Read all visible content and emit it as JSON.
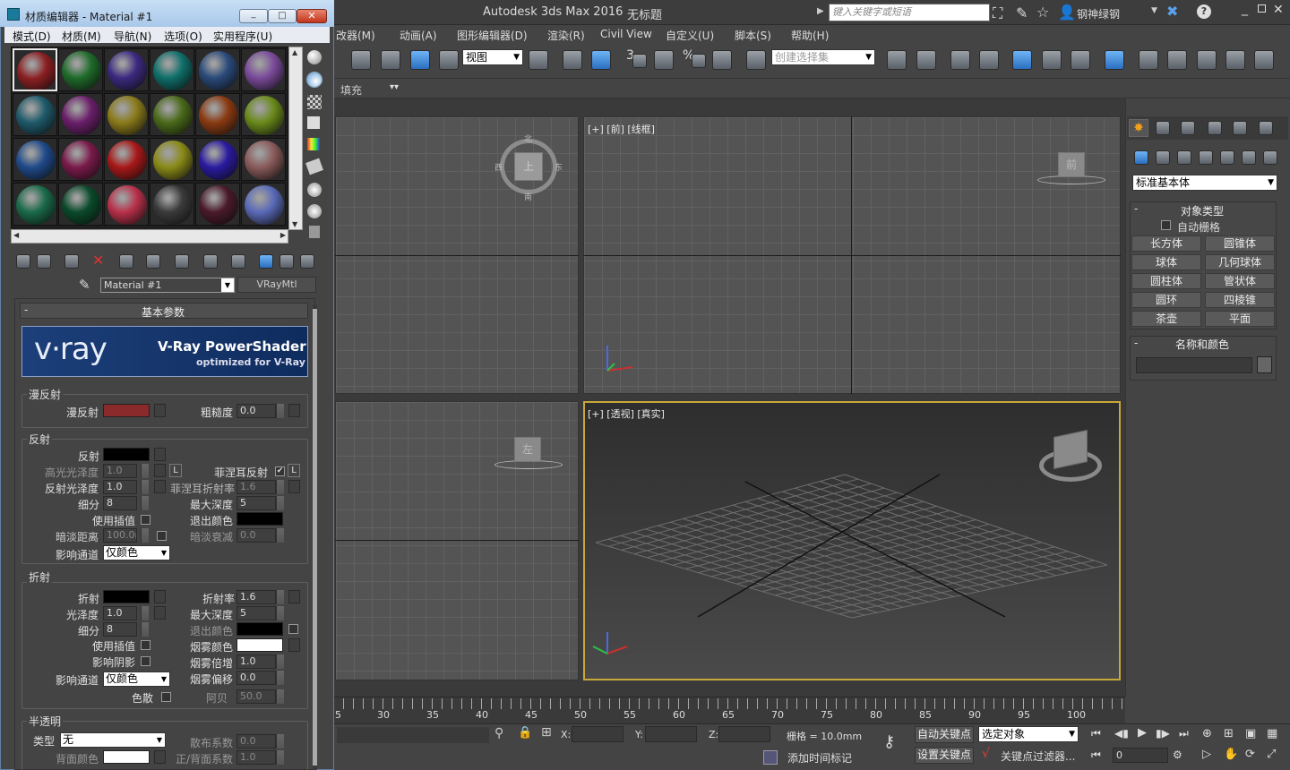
{
  "app": {
    "title": "Autodesk 3ds Max 2016",
    "doc_title": "无标题",
    "search_placeholder": "键入关键字或短语",
    "user": "钢神绿钢"
  },
  "menu": [
    "改器(M)",
    "动画(A)",
    "图形编辑器(D)",
    "渲染(R)",
    "Civil View",
    "自定义(U)",
    "脚本(S)",
    "帮助(H)"
  ],
  "toolbar": {
    "view_select": "视图",
    "selection_set": "创建选择集",
    "snap_3": "3",
    "snap_pct": "%"
  },
  "ribbon_row": {
    "fill_label": "填充"
  },
  "viewports": {
    "top_right_label": "[+] [前] [线框]",
    "bottom_right_label": "[+] [透视] [真实]",
    "front_cube": "前",
    "top_cube": "上",
    "left_cube": "左",
    "compass": [
      "北",
      "南",
      "东",
      "西"
    ]
  },
  "command_panel": {
    "category": "标准基本体",
    "rollout_object_type": "对象类型",
    "autogrid": "自动栅格",
    "buttons": [
      "长方体",
      "圆锥体",
      "球体",
      "几何球体",
      "圆柱体",
      "管状体",
      "圆环",
      "四棱锥",
      "茶壶",
      "平面"
    ],
    "rollout_name_color": "名称和颜色"
  },
  "timeline": {
    "ticks": [
      "5",
      "30",
      "35",
      "40",
      "45",
      "50",
      "55",
      "60",
      "65",
      "70",
      "75",
      "80",
      "85",
      "90",
      "95",
      "100"
    ]
  },
  "status": {
    "x_label": "X:",
    "y_label": "Y:",
    "z_label": "Z:",
    "grid": "栅格 = 10.0mm",
    "add_time_tag": "添加时间标记",
    "auto_key": "自动关键点",
    "set_key": "设置关键点",
    "selected_object": "选定对象",
    "key_filters": "关键点过滤器...",
    "frame": "0"
  },
  "mat_editor": {
    "title": "材质编辑器 - Material #1",
    "menu": [
      "模式(D)",
      "材质(M)",
      "导航(N)",
      "选项(O)",
      "实用程序(U)"
    ],
    "material_name": "Material #1",
    "material_type": "VRayMtl",
    "rollout_basic": "基本参数",
    "vray_brand": "v·ray",
    "vray_banner_title": "V-Ray PowerShader",
    "vray_banner_sub": "optimized for V-Ray",
    "sphere_colors": [
      "#8a1f22",
      "#1f6b2a",
      "#3c2a80",
      "#0f6f6a",
      "#2a4a7a",
      "#7a4a9a",
      "#1e5a6a",
      "#6a1f6a",
      "#8a7a1a",
      "#4a6a1a",
      "#8a3a12",
      "#6a8a1a",
      "#1f4a8a",
      "#7a1a4a",
      "#a81818",
      "#8a8a18",
      "#2a1aa0",
      "#8a5a5a",
      "#1a6a4a",
      "#0a4a2a",
      "#b8304a",
      "#3a3a3a",
      "#4a1a2a",
      "#5a6ab8"
    ],
    "diffuse": {
      "section": "漫反射",
      "diffuse_label": "漫反射",
      "diffuse_color": "#8b2a2a",
      "rough_label": "粗糙度",
      "rough_value": "0.0"
    },
    "reflect": {
      "section": "反射",
      "reflect_label": "反射",
      "reflect_color": "#000000",
      "hilight_label": "高光光泽度",
      "hilight_value": "1.0",
      "gloss_label": "反射光泽度",
      "gloss_value": "1.0",
      "subdiv_label": "细分",
      "subdiv_value": "8",
      "interp_label": "使用插值",
      "dimdist_label": "暗淡距离",
      "dimdist_value": "100.0m",
      "affect_label": "影响通道",
      "affect_value": "仅颜色",
      "fresnel_label": "菲涅耳反射",
      "fresnel_ior_label": "菲涅耳折射率",
      "fresnel_ior_value": "1.6",
      "maxdepth_label": "最大深度",
      "maxdepth_value": "5",
      "exit_label": "退出颜色",
      "exit_color": "#000000",
      "dimfall_label": "暗淡衰减",
      "dimfall_value": "0.0",
      "lock": "L"
    },
    "refract": {
      "section": "折射",
      "refract_label": "折射",
      "refract_color": "#000000",
      "gloss_label": "光泽度",
      "gloss_value": "1.0",
      "subdiv_label": "细分",
      "subdiv_value": "8",
      "interp_label": "使用插值",
      "shadow_label": "影响阴影",
      "affect_label": "影响通道",
      "affect_value": "仅颜色",
      "disp_label": "色散",
      "ior_label": "折射率",
      "ior_value": "1.6",
      "maxdepth_label": "最大深度",
      "maxdepth_value": "5",
      "exit_label": "退出颜色",
      "exit_color": "#000000",
      "fog_label": "烟雾颜色",
      "fog_color": "#ffffff",
      "fogmult_label": "烟雾倍增",
      "fogmult_value": "1.0",
      "fogbias_label": "烟雾偏移",
      "fogbias_value": "0.0",
      "abbe_label": "阿贝",
      "abbe_value": "50.0"
    },
    "translucent": {
      "section": "半透明",
      "type_label": "类型",
      "type_value": "无",
      "back_label": "背面颜色",
      "back_color": "#ffffff",
      "scatter_label": "散布系数",
      "scatter_value": "0.0",
      "fb_label": "正/背面系数",
      "fb_value": "1.0"
    }
  }
}
